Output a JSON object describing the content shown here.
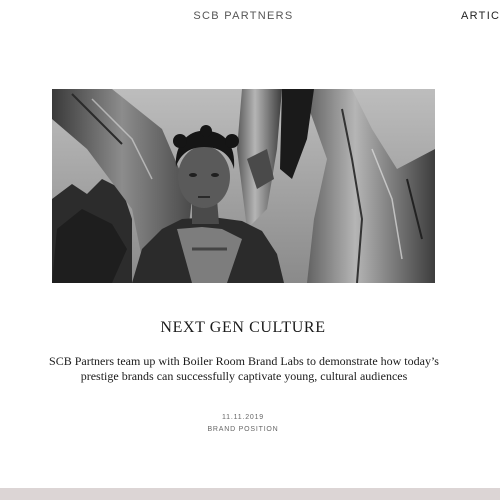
{
  "header": {
    "brand": "SCB PARTNERS",
    "nav": [
      {
        "label": "ARTICLES"
      }
    ]
  },
  "article": {
    "title": "NEXT GEN CULTURE",
    "summary": "SCB Partners team up with Boiler Room Brand Labs to demonstrate how today’s prestige brands can successfully captivate young, cultural audiences",
    "date": "11.11.2019",
    "category": "BRAND POSITION",
    "image_description_icon": "photo-icon"
  },
  "colors": {
    "footer_band": "#dcd5d5",
    "text_primary": "#1a1a1a",
    "text_muted": "#666666"
  }
}
